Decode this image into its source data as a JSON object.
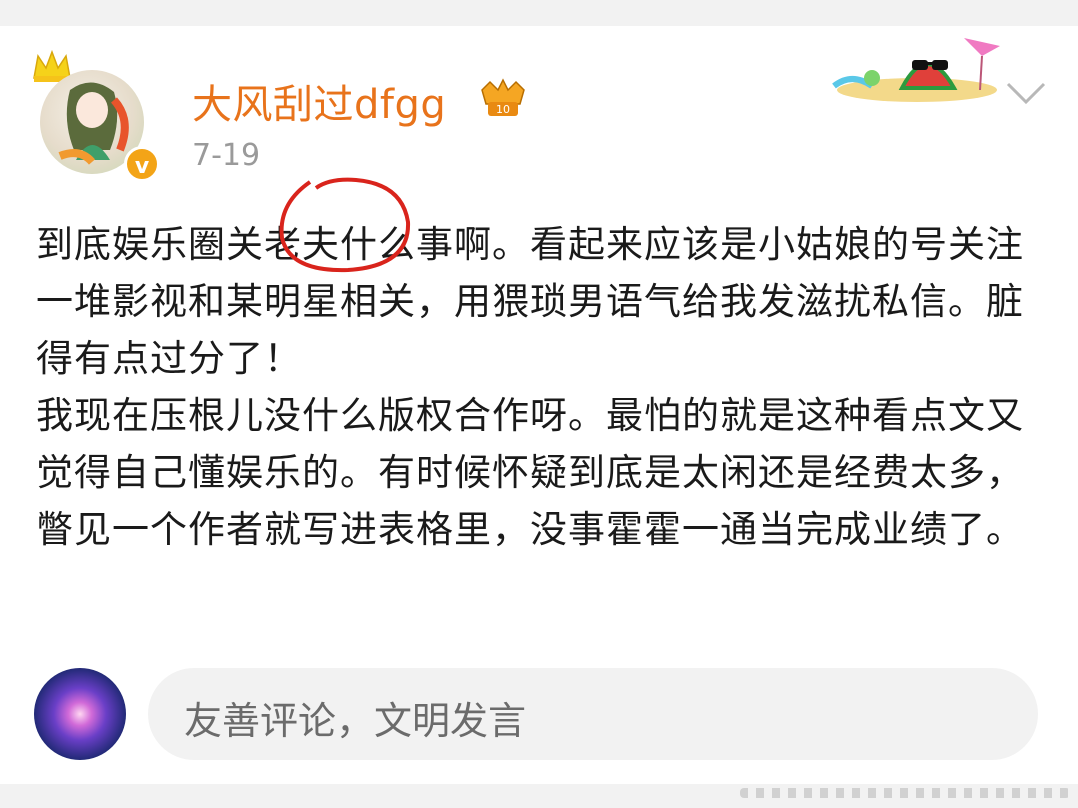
{
  "post": {
    "username": "大风刮过dfgg",
    "date": "7-19",
    "verified_mark": "v",
    "vip_badge": "vip-badge-icon",
    "paragraphs": [
      "到底娱乐圈关老夫什么事啊。看起来应该是小姑娘的号关注一堆影视和某明星相关，用猥琐男语气给我发滋扰私信。脏得有点过分了！",
      "我现在压根儿没什么版权合作呀。最怕的就是这种看点文又觉得自己懂娱乐的。有时候怀疑到底是太闲还是经费太多，瞥见一个作者就写进表格里，没事霍霍一通当完成业绩了。"
    ]
  },
  "comment": {
    "placeholder": "友善评论，文明发言"
  },
  "colors": {
    "username": "#e8731b",
    "verified": "#f3a417",
    "annotation": "#d9241c"
  },
  "icons": [
    "crown-icon",
    "verified-icon",
    "vip-badge-icon",
    "watermelon-sticker-icon",
    "chevron-down-icon"
  ]
}
